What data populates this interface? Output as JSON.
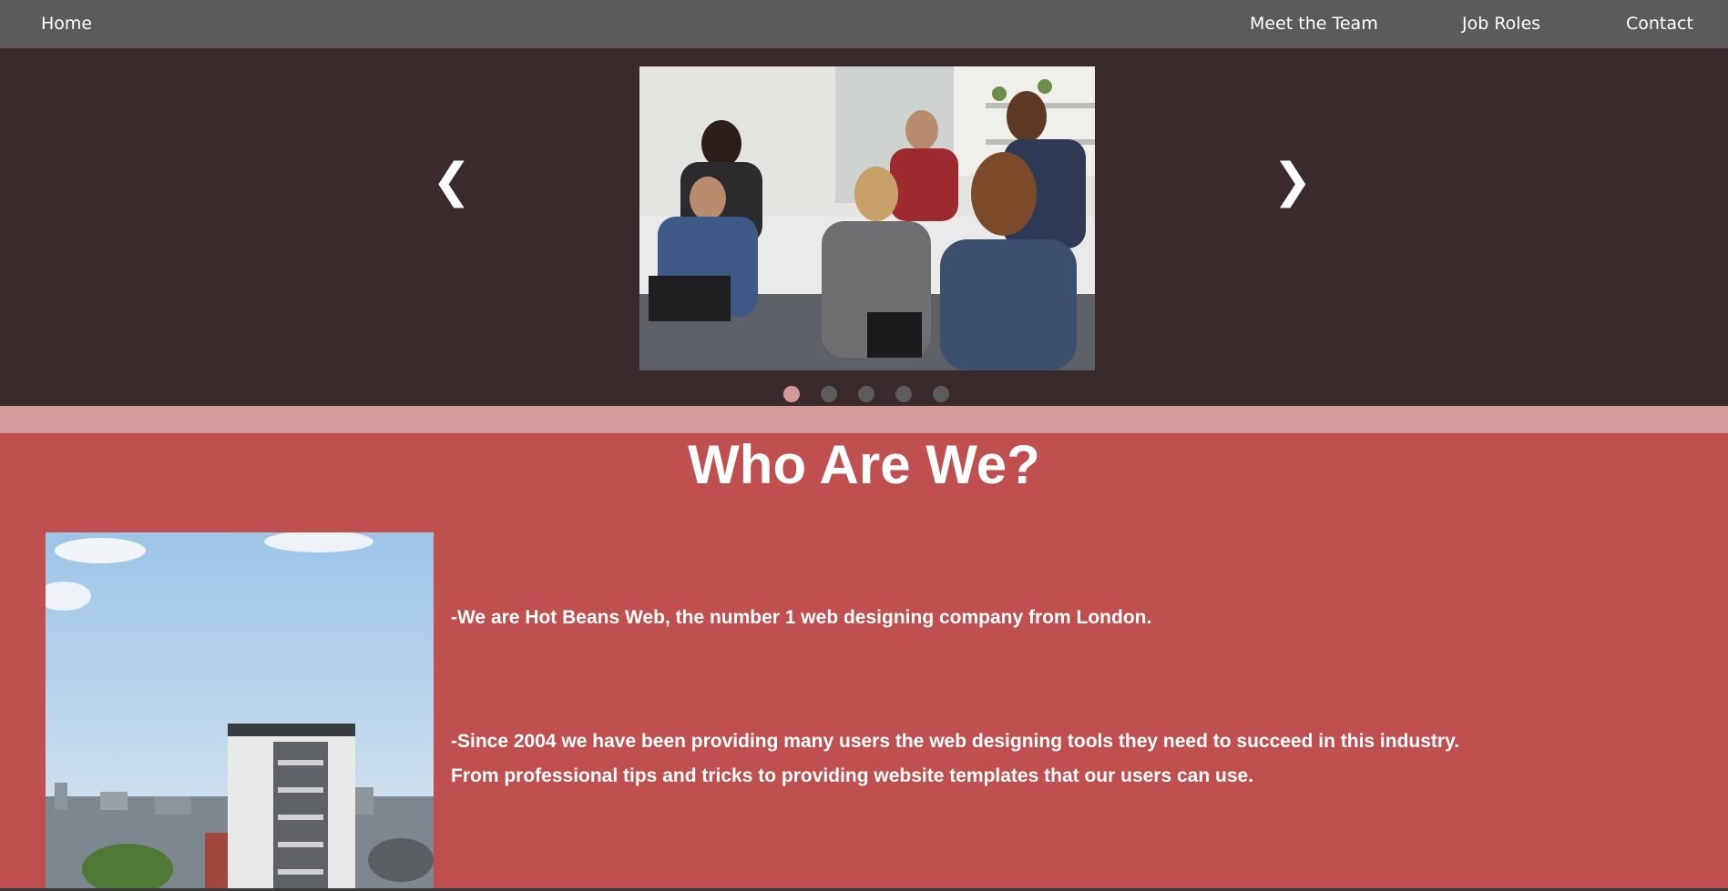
{
  "nav": {
    "home": "Home",
    "meet_team": "Meet the Team",
    "job_roles": "Job Roles",
    "contact": "Contact"
  },
  "carousel": {
    "prev_glyph": "❮",
    "next_glyph": "❯",
    "slide_count": 5,
    "active_index": 0,
    "image_alt": "team-meeting-photo"
  },
  "about": {
    "heading": "Who Are We?",
    "paragraph1": "-We are Hot Beans Web, the number 1 web designing company from London.",
    "paragraph2_line1": "-Since 2004 we have been providing many users the web designing tools they need to succeed in this industry.",
    "paragraph2_line2": "From professional tips and tricks to providing website templates that our users can use.",
    "image_alt": "office-building-photo"
  },
  "colors": {
    "nav_bg": "#5c5b5a",
    "hero_bg": "#3b2a2b",
    "band": "#d59a9b",
    "section_bg": "#c04f4f",
    "dot_active": "#d59a9b",
    "dot_inactive": "#5e5b5b"
  }
}
